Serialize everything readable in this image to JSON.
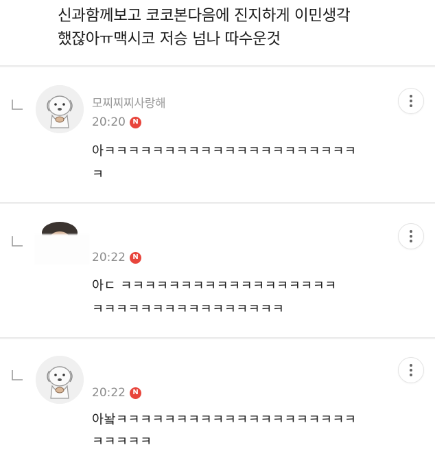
{
  "post": {
    "line1": "신과함께보고 코코본다음에 진지하게 이민생각",
    "line2": "했잖아ㅠ맥시코 저승 넘나 따수운것"
  },
  "comments": [
    {
      "nickname": "모찌찌찌사랑해",
      "time": "20:20",
      "new_badge": "N",
      "text_line1": "아ㅋㅋㅋㅋㅋㅋㅋㅋㅋㅋㅋㅋㅋㅋㅋㅋㅋㅋㅋㅋㅋ",
      "text_line2": "ㅋ"
    },
    {
      "nickname": "",
      "time": "20:22",
      "new_badge": "N",
      "text_line1": "아ㄷ      ㅋㅋㅋㅋㅋㅋㅋㅋㅋㅋㅋㅋㅋㅋㅋㅋㅋㅋ",
      "text_line2": "ㅋㅋㅋㅋㅋㅋㅋㅋㅋㅋㅋㅋㅋㅋㅋㅋ"
    },
    {
      "nickname": "",
      "time": "20:22",
      "new_badge": "N",
      "text_line1": "아놬ㅋㅋㅋㅋㅋㅋㅋㅋㅋㅋㅋㅋㅋㅋㅋㅋㅋㅋㅋㅋ",
      "text_line2": "ㅋㅋㅋㅋㅋ"
    }
  ],
  "icons": {
    "reply": "reply-arrow-icon",
    "more": "more-vertical-icon",
    "new": "new-badge-icon"
  },
  "colors": {
    "new_badge": "#e8453c",
    "nickname": "#9a9a9a",
    "time": "#8c8c8c"
  }
}
